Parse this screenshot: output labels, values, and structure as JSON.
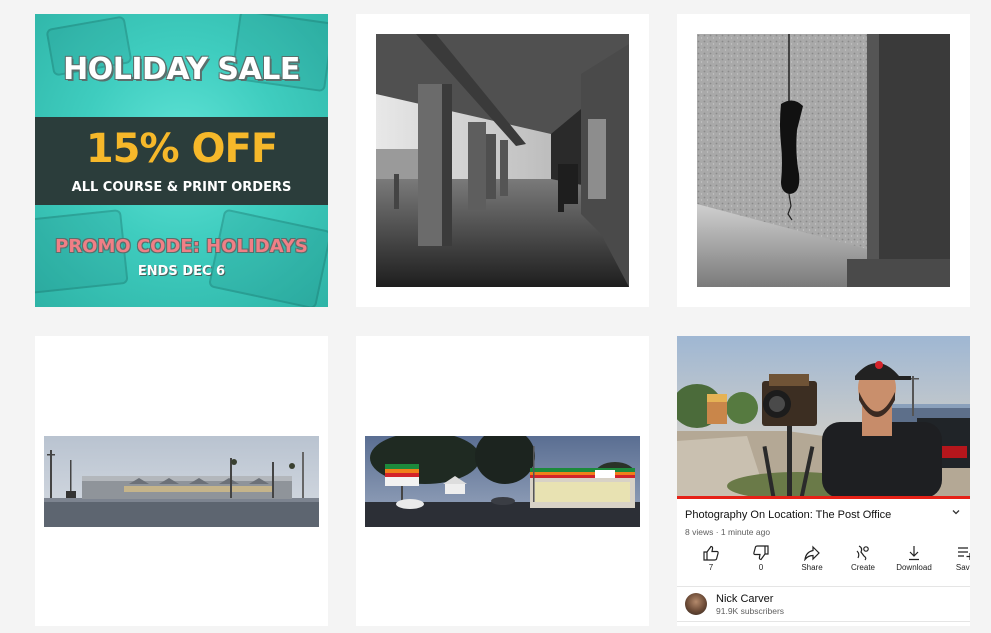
{
  "promo": {
    "title": "HOLIDAY SALE",
    "discount": "15% OFF",
    "subtitle": "ALL COURSE & PRINT ORDERS",
    "code": "PROMO CODE: HOLIDAYS",
    "ends": "ENDS DEC 6"
  },
  "video": {
    "title": "Photography On Location: The Post Office",
    "meta": "8 views · 1 minute ago",
    "actions": [
      {
        "label": "7",
        "icon": "thumbs-up-icon"
      },
      {
        "label": "0",
        "icon": "thumbs-down-icon"
      },
      {
        "label": "Share",
        "icon": "share-icon"
      },
      {
        "label": "Create",
        "icon": "create-icon"
      },
      {
        "label": "Download",
        "icon": "download-icon"
      },
      {
        "label": "Save",
        "icon": "save-icon"
      }
    ],
    "channel": "Nick Carver",
    "subscribers": "91.9K subscribers"
  },
  "colors": {
    "promo_teal": "#3fcdbf",
    "promo_band": "#2b3d3b",
    "promo_orange": "#f6b82a",
    "promo_pink": "#f07f86",
    "youtube_red": "#e62117"
  }
}
